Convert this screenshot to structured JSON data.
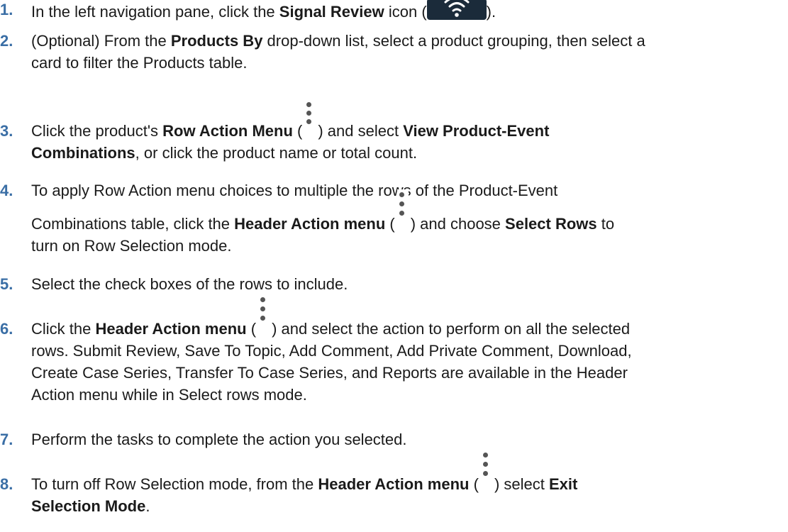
{
  "steps": [
    {
      "num": "1.",
      "parts": {
        "a": "In the left navigation pane, click the ",
        "b": "Signal Review",
        "c": " icon (",
        "d": ")."
      }
    },
    {
      "num": "2.",
      "parts": {
        "a": "(Optional) From the ",
        "b": "Products By",
        "c": " drop-down list, select a product grouping, then select a",
        "line2": "card to filter the Products table."
      }
    },
    {
      "num": "3.",
      "parts": {
        "a": "Click the product's ",
        "b": "Row Action Menu",
        "c": " (",
        "d": ") and select ",
        "e": "View Product-Event",
        "line2_b": "Combinations",
        "line2_c": ", or click the product name or total count."
      }
    },
    {
      "num": "4.",
      "parts": {
        "line1": "To apply Row Action menu choices to multiple the rows of the Product-Event",
        "a": "Combinations table, click the ",
        "b": "Header Action menu",
        "c": " (",
        "d": ") and choose ",
        "e": "Select Rows",
        "f": " to",
        "line3": "turn on Row Selection mode."
      }
    },
    {
      "num": "5.",
      "parts": {
        "a": "Select the check boxes of the rows to include."
      }
    },
    {
      "num": "6.",
      "parts": {
        "a": "Click the ",
        "b": "Header Action menu",
        "c": " (",
        "d": ") and select the action to perform on all the selected",
        "line2": "rows. Submit Review, Save To Topic, Add Comment, Add Private Comment, Download,",
        "line3": "Create Case Series, Transfer To Case Series, and Reports are available in the Header",
        "line4": "Action menu while in Select rows mode."
      }
    },
    {
      "num": "7.",
      "parts": {
        "a": "Perform the tasks to complete the action you selected."
      }
    },
    {
      "num": "8.",
      "parts": {
        "a": "To turn off Row Selection mode, from the ",
        "b": "Header Action menu",
        "c": " (",
        "d": ") select ",
        "e": "Exit",
        "line2_b": "Selection Mode",
        "line2_c": "."
      }
    }
  ],
  "icons": {
    "signal_review": "wifi-signal-icon",
    "row_action": "vertical-ellipsis-icon",
    "header_action": "vertical-ellipsis-icon"
  },
  "colors": {
    "step_number": "#3a6ea5",
    "icon_dark_bg": "#1b2b3a",
    "kebab_dot": "#555555"
  }
}
